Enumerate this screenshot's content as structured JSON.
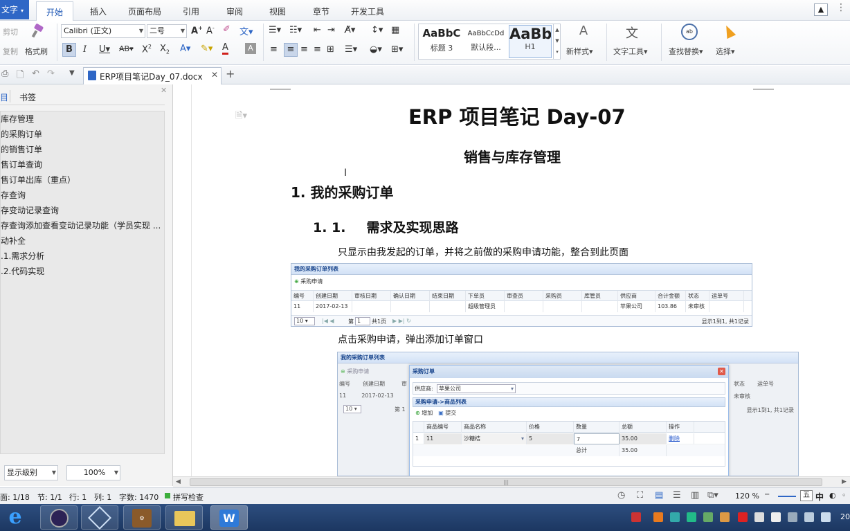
{
  "app": {
    "label": "文字",
    "accent": "#2f67c6"
  },
  "ribbon_tabs": [
    "开始",
    "插入",
    "页面布局",
    "引用",
    "审阅",
    "视图",
    "章节",
    "开发工具"
  ],
  "active_tab": "开始",
  "clipboard": {
    "cut": "剪切",
    "copy": "复制",
    "format_painter": "格式刷"
  },
  "font": {
    "name": "Calibri (正文)",
    "size": "二号"
  },
  "styles": [
    {
      "preview": "AaBbC",
      "name": "标题 3"
    },
    {
      "preview": "AaBbCcDd",
      "name": "默认段..."
    },
    {
      "preview": "AaBb",
      "name": "H1"
    }
  ],
  "ribbon_right": {
    "new_style": "新样式",
    "text_tools": "文字工具",
    "find_replace": "查找替换",
    "select": "选择"
  },
  "doc_tab": {
    "filename": "ERP项目笔记Day_07.docx"
  },
  "nav": {
    "tabs": [
      "目",
      "书签"
    ],
    "items": [
      "库存管理",
      "的采购订单",
      "的销售订单",
      "售订单查询",
      "售订单出库（重点）",
      "存查询",
      "存变动记录查询",
      "存查询添加查看变动记录功能（学员实现 ...",
      "动补全",
      ".1.需求分析",
      ".2.代码实现"
    ],
    "level_select": "显示级别",
    "zoom_select": "100%"
  },
  "document": {
    "title": "ERP 项目笔记  Day-07",
    "subtitle": "销售与库存管理",
    "heading1": "1.  我的采购订单",
    "heading2_num": "1. 1.",
    "heading2": "需求及实现思路",
    "para1": "只显示由我发起的订单，并将之前做的采购申请功能，整合到此页面",
    "para2": "点击采购申请，弹出添加订单窗口"
  },
  "shot1": {
    "title": "我的采购订单列表",
    "toolbar": "采购申请",
    "headers": [
      "编号",
      "创建日期",
      "审核日期",
      "确认日期",
      "结束日期",
      "下单员",
      "审查员",
      "采购员",
      "库管员",
      "供应商",
      "合计金额",
      "状态",
      "运单号"
    ],
    "row": [
      "11",
      "2017-02-13",
      "",
      "",
      "",
      "超级管理员",
      "",
      "",
      "",
      "苹果公司",
      "103.86",
      "未审核",
      ""
    ],
    "pager": {
      "size": "10",
      "page_label": "第",
      "page": "1",
      "total": "共1页",
      "info": "显示1到1, 共1记录"
    }
  },
  "shot2": {
    "title": "我的采购订单列表",
    "toolbar": "采购申请",
    "headers_left": [
      "编号",
      "创建日期",
      "审"
    ],
    "row_left": [
      "11",
      "2017-02-13"
    ],
    "headers_right": [
      "状态",
      "运单号"
    ],
    "row_right": [
      "未审核"
    ],
    "pager_size": "10",
    "pager_page": "第 1",
    "pager_info": "显示1到1, 共1记录",
    "dialog": {
      "title": "采购订单",
      "supplier_label": "供应商:",
      "supplier_value": "苹果公司",
      "section": "采购申请->商品列表",
      "add": "增加",
      "submit": "提交",
      "headers": [
        "商品编号",
        "商品名称",
        "价格",
        "数量",
        "总额",
        "操作"
      ],
      "row": {
        "num": "1",
        "code": "11",
        "name": "沙糖桔",
        "price": "5",
        "qty": "7",
        "total": "35.00",
        "op": "删除"
      },
      "sum_label": "总计",
      "sum_value": "35.00"
    }
  },
  "status": {
    "page": "面: 1/18",
    "section": "节: 1/1",
    "line": "行: 1",
    "col": "列: 1",
    "words": "字数: 1470",
    "spell": "拼写检查",
    "zoom": "120 %"
  },
  "tray": {
    "time": "20",
    "ime": "中"
  }
}
